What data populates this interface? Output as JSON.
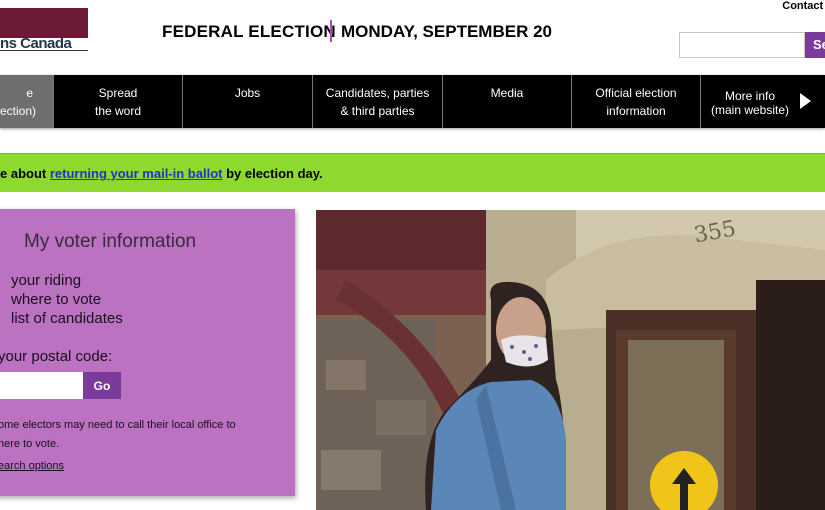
{
  "header": {
    "logo_text": "ns Canada",
    "title": "FEDERAL ELECTION",
    "date": "MONDAY, SEPTEMBER 20",
    "contact": "Contact u",
    "search_button": "Se"
  },
  "nav": {
    "items": [
      {
        "line1": "e",
        "line2": "ection)"
      },
      {
        "line1": "Spread",
        "line2": "the word"
      },
      {
        "line1": "Jobs",
        "line2": ""
      },
      {
        "line1": "Candidates, parties",
        "line2": "& third parties"
      },
      {
        "line1": "Media",
        "line2": ""
      },
      {
        "line1": "Official election",
        "line2": "information"
      },
      {
        "line1": "More info",
        "line2": "(main website)"
      }
    ]
  },
  "notice": {
    "before": "e about ",
    "link": "returning your mail-in ballot",
    "after": " by election day."
  },
  "voter_card": {
    "title": "My voter information",
    "items": [
      "your riding",
      "where to vote",
      "list of candidates"
    ],
    "postal_label": "your postal code:",
    "go_button": "Go",
    "note_line1": "ome electors may need to call their local office to",
    "note_line2": "here to vote.",
    "search_link": "earch options"
  },
  "photo": {
    "building_number": "355"
  }
}
